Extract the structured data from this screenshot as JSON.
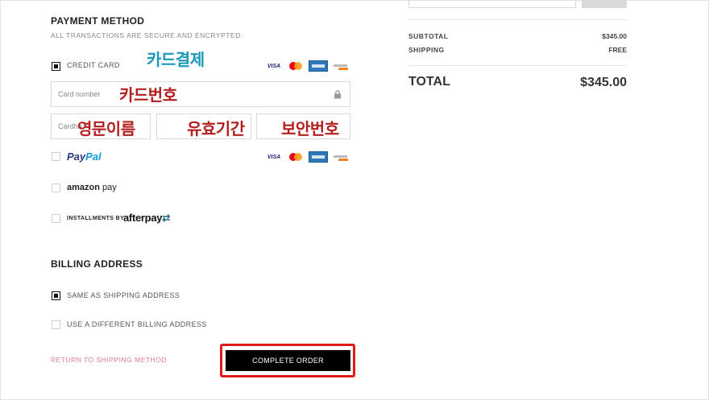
{
  "payment": {
    "title": "PAYMENT METHOD",
    "subtitle": "ALL TRANSACTIONS ARE SECURE AND ENCRYPTED.",
    "credit_card_label": "CREDIT CARD",
    "credit_card_checked": true,
    "card_number_placeholder": "Card number",
    "cardholder_placeholder": "Cardho",
    "expiry_placeholder": "",
    "cvv_placeholder": "",
    "paypal_label_1": "Pay",
    "paypal_label_2": "Pal",
    "amazon_label_1": "amazon",
    "amazon_label_2": " pay",
    "installments_label": "INSTALLMENTS BY",
    "afterpay_label": "afterpay",
    "afterpay_arrow": "⇄",
    "visa_label": "VISA"
  },
  "annotations": {
    "card_payment": "카드결제",
    "card_number": "카드번호",
    "english_name": "영문이름",
    "expiry": "유효기간",
    "security_code": "보안번호"
  },
  "billing": {
    "title": "BILLING ADDRESS",
    "same_label": "SAME AS SHIPPING ADDRESS",
    "same_checked": true,
    "different_label": "USE A DIFFERENT BILLING ADDRESS",
    "different_checked": false
  },
  "actions": {
    "return_label": "RETURN TO SHIPPING METHOD",
    "complete_label": "COMPLETE ORDER",
    "highlight_color": "#e0191b"
  },
  "summary": {
    "subtotal_label": "SUBTOTAL",
    "subtotal_value": "$345.00",
    "shipping_label": "SHIPPING",
    "shipping_value": "FREE",
    "total_label": "TOTAL",
    "total_value": "$345.00"
  },
  "colors": {
    "link": "#e07a8e",
    "annotation_teal": "#1897b9",
    "annotation_red": "#b51e1e",
    "button_bg": "#000000"
  }
}
